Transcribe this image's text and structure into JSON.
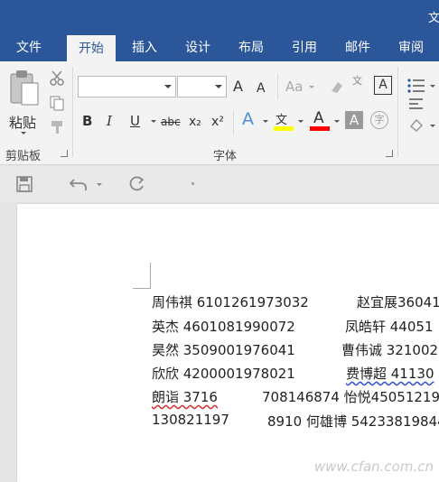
{
  "window": {
    "title": "文"
  },
  "tabs": [
    {
      "label": "文件"
    },
    {
      "label": "开始",
      "active": true
    },
    {
      "label": "插入"
    },
    {
      "label": "设计"
    },
    {
      "label": "布局"
    },
    {
      "label": "引用"
    },
    {
      "label": "邮件"
    },
    {
      "label": "审阅"
    }
  ],
  "ribbon": {
    "clipboard": {
      "paste_label": "粘贴",
      "group_label": "剪贴板"
    },
    "font": {
      "group_label": "字体",
      "font_name_value": "",
      "font_size_value": "",
      "bold": "B",
      "italic": "I",
      "underline": "U",
      "strike": "abc",
      "subscript": "x₂",
      "superscript": "x²",
      "grow": "A",
      "shrink": "A",
      "case": "Aa",
      "wen": "文",
      "boxed": "A",
      "text_effect": "A",
      "font_color": "A",
      "char_shade": "A",
      "enclose": "字"
    }
  },
  "colors": {
    "accent": "#2b579a",
    "highlight": "#ffff00",
    "font_color": "#ff0000"
  },
  "document": {
    "lines": [
      {
        "left": "周伟祺 6101261973032",
        "right": "赵宜展36041"
      },
      {
        "left": "英杰 4601081990072",
        "right": "凤皓轩 44051"
      },
      {
        "left": "昊然 3509001976041",
        "right": "曹伟诚 321002"
      },
      {
        "left": "欣欣  4200001978021",
        "right": "费博超 41130"
      },
      {
        "left": "朗诣 3716",
        "right": "708146874 怡悦45051219"
      },
      {
        "left": "130821197",
        "right": "8910 何雄博 54233819844"
      }
    ]
  },
  "watermark": "www.cfan.com.cn"
}
